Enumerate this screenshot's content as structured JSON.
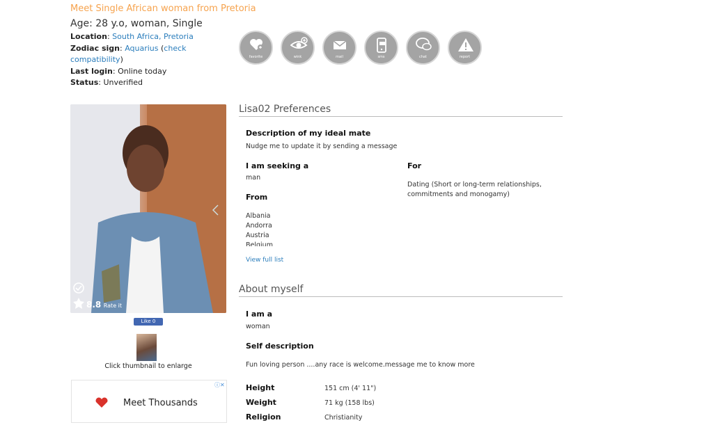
{
  "profile": {
    "title": "Meet Single African woman from Pretoria",
    "age_line": "Age: 28 y.o, woman, Single",
    "location_label": "Location",
    "location_value": "South Africa, Pretoria",
    "zodiac_label": "Zodiac sign",
    "zodiac_value": "Aquarius",
    "zodiac_check": "check compatibility",
    "last_login_label": "Last login",
    "last_login_value": "Online today",
    "status_label": "Status",
    "status_value": "Unverified"
  },
  "actions": [
    {
      "icon": "heart-plus-icon",
      "label": "favorite"
    },
    {
      "icon": "eye-icon",
      "label": "wink"
    },
    {
      "icon": "envelope-icon",
      "label": "mail"
    },
    {
      "icon": "phone-icon",
      "label": "sms"
    },
    {
      "icon": "chat-bubbles-icon",
      "label": "chat"
    },
    {
      "icon": "warning-icon",
      "label": "report"
    }
  ],
  "photo": {
    "rating": "8.8",
    "rate_label": "Rate it",
    "like_label": "Like 0",
    "thumb_caption": "Click thumbnail to enlarge"
  },
  "preferences": {
    "heading": "Lisa02 Preferences",
    "ideal_label": "Description of my ideal mate",
    "ideal_value": "Nudge me to update it by sending a message",
    "seeking_label": "I am seeking a",
    "seeking_value": "man",
    "for_label": "For",
    "for_value": "Dating (Short or long-term relationships, commitments and monogamy)",
    "from_label": "From",
    "countries": [
      "Albania",
      "Andorra",
      "Austria",
      "Belgium"
    ],
    "view_full": "View full list"
  },
  "about": {
    "heading": "About myself",
    "iam_label": "I am a",
    "iam_value": "woman",
    "selfdesc_label": "Self description",
    "selfdesc_value": "Fun loving person ....any race is welcome.message me to know more",
    "rows": [
      {
        "label": "Height",
        "value": "151 cm (4' 11\")"
      },
      {
        "label": "Weight",
        "value": "71 kg (158 lbs)"
      },
      {
        "label": "Religion",
        "value": "Christianity"
      }
    ]
  },
  "ad": {
    "text": "Meet Thousands"
  },
  "colors": {
    "title": "#f6a34e",
    "link": "#2a7dbc",
    "icon_bg": "#a4a4a4"
  }
}
